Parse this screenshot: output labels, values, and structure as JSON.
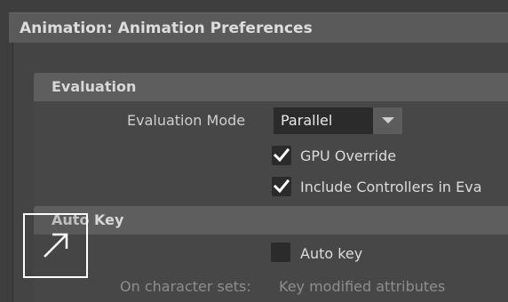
{
  "window": {
    "title": "Animation: Animation Preferences"
  },
  "evaluation": {
    "header": "Evaluation",
    "mode_label": "Evaluation Mode",
    "mode_value": "Parallel",
    "gpu_override": {
      "label": "GPU Override",
      "checked": true
    },
    "include_controllers": {
      "label": "Include Controllers in Eva",
      "checked": true
    }
  },
  "auto_key": {
    "header": "Auto Key",
    "auto_key_option": {
      "label": "Auto key",
      "checked": false
    },
    "character_sets_label": "On character sets:",
    "character_sets_value": "Key modified attributes"
  },
  "icons": {
    "overlay": "expand-arrow-icon",
    "dropdown": "chevron-down-icon",
    "check": "checkmark-icon"
  }
}
